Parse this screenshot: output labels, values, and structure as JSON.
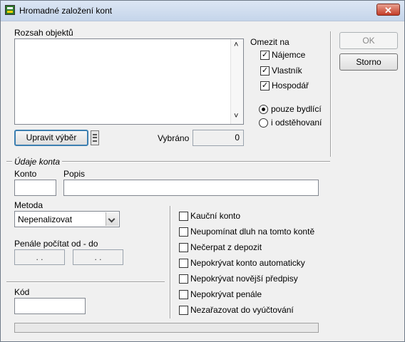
{
  "window": {
    "title": "Hromadné založení kont",
    "close_glyph": "✕"
  },
  "range": {
    "label": "Rozsah objektů",
    "scroll_up": "˄",
    "scroll_down": "˅",
    "edit_button": "Upravit výběr",
    "selected_label": "Vybráno",
    "selected_value": "0"
  },
  "limit": {
    "label": "Omezit na",
    "options": [
      {
        "label": "Nájemce",
        "checked": true
      },
      {
        "label": "Vlastník",
        "checked": true
      },
      {
        "label": "Hospodář",
        "checked": true
      }
    ],
    "radios": [
      {
        "label": "pouze bydlící",
        "selected": true
      },
      {
        "label": "i odstěhovaní",
        "selected": false
      }
    ]
  },
  "buttons": {
    "ok": "OK",
    "cancel": "Storno"
  },
  "account": {
    "section_label": "Údaje konta",
    "konto_label": "Konto",
    "konto_value": "",
    "popis_label": "Popis",
    "popis_value": "",
    "method_label": "Metoda",
    "method_value": "Nepenalizovat",
    "penalty_label": "Penále počítat od - do",
    "date_from": ". .",
    "date_to": ". .",
    "kod_label": "Kód",
    "kod_value": ""
  },
  "flags": [
    {
      "label": "Kauční konto",
      "checked": false
    },
    {
      "label": "Neupomínat dluh na tomto kontě",
      "checked": false
    },
    {
      "label": "Nečerpat z depozit",
      "checked": false
    },
    {
      "label": "Nepokrývat konto automaticky",
      "checked": false
    },
    {
      "label": "Nepokrývat novější předpisy",
      "checked": false
    },
    {
      "label": "Nepokrývat penále",
      "checked": false
    },
    {
      "label": "Nezařazovat do vyúčtování",
      "checked": false
    }
  ]
}
